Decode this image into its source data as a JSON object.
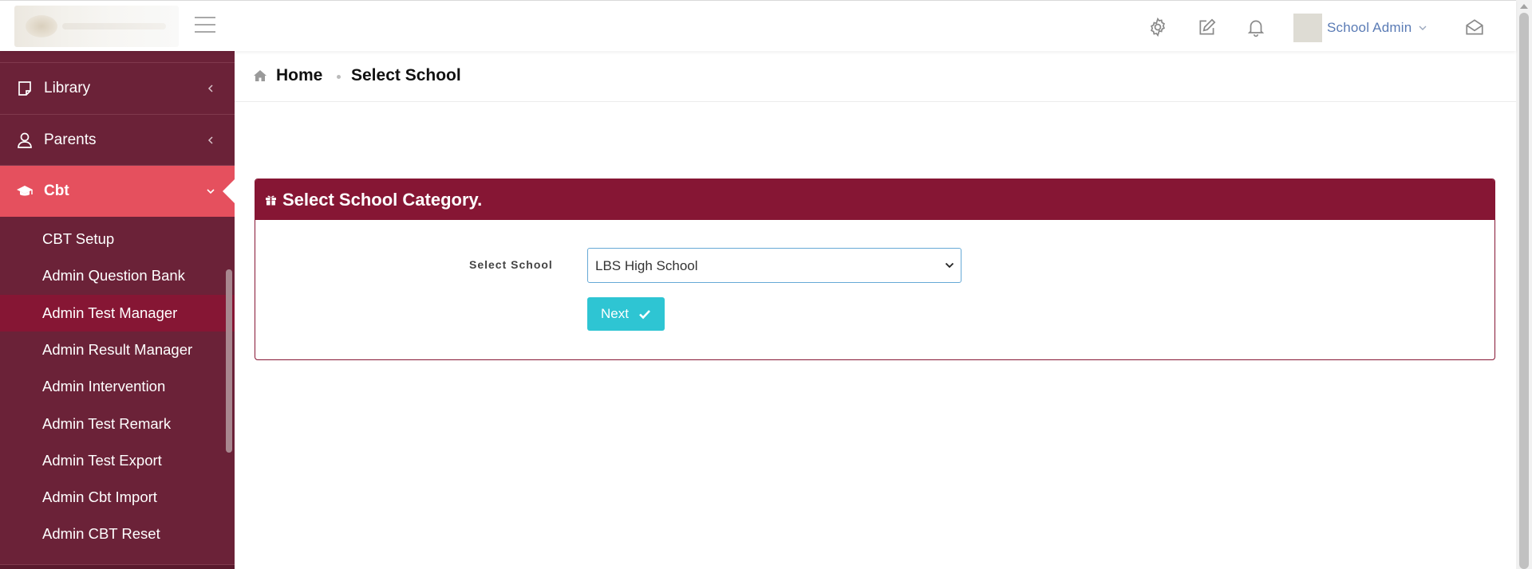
{
  "header": {
    "user_name": "School Admin",
    "icons": [
      "settings-icon",
      "edit-icon",
      "bell-icon",
      "envelope-open-icon"
    ]
  },
  "sidebar": {
    "items": [
      {
        "label": "Library",
        "icon": "notepad-icon"
      },
      {
        "label": "Parents",
        "icon": "user-icon"
      },
      {
        "label": "Cbt",
        "icon": "graduation-cap-icon",
        "active": true
      }
    ],
    "submenu": [
      {
        "label": "CBT Setup"
      },
      {
        "label": "Admin Question Bank"
      },
      {
        "label": "Admin Test Manager",
        "current": true
      },
      {
        "label": "Admin Result Manager"
      },
      {
        "label": "Admin Intervention"
      },
      {
        "label": "Admin Test Remark"
      },
      {
        "label": "Admin Test Export"
      },
      {
        "label": "Admin Cbt Import"
      },
      {
        "label": "Admin CBT Reset"
      }
    ]
  },
  "breadcrumb": {
    "home": "Home",
    "current": "Select School"
  },
  "panel": {
    "title": "Select School Category.",
    "field_label": "Select School",
    "selected_school": "LBS High School",
    "next_label": "Next"
  },
  "colors": {
    "sidebar_bg": "#6b2238",
    "active_item": "#e5505e",
    "current_sub_item": "#861634",
    "panel_header": "#861634",
    "next_button": "#2ec5d3",
    "user_name": "#5a7bb5"
  }
}
